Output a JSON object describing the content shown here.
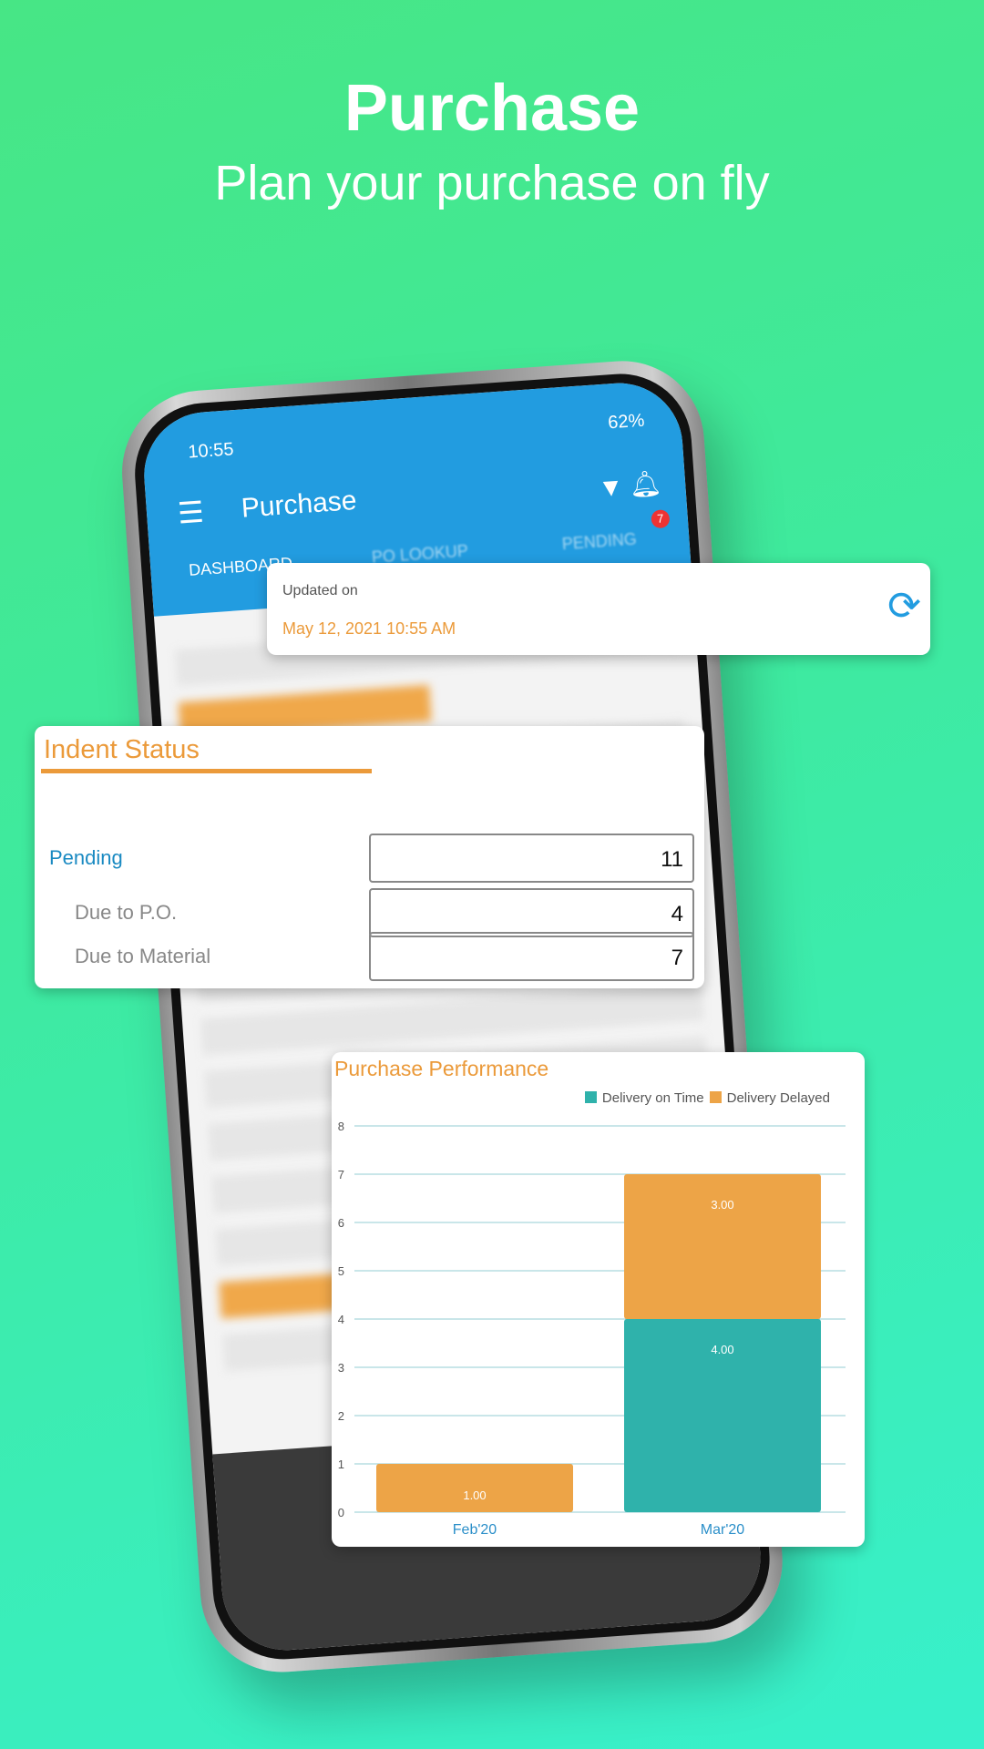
{
  "hero": {
    "title": "Purchase",
    "subtitle": "Plan your purchase on fly"
  },
  "phone": {
    "status": {
      "time": "10:55",
      "battery": "62%"
    },
    "app_title": "Purchase",
    "notification_count": "7",
    "tabs": [
      "DASHBOARD",
      "PO LOOKUP",
      "PENDING"
    ]
  },
  "updated": {
    "label": "Updated on",
    "value": "May 12, 2021 10:55 AM"
  },
  "indent": {
    "title": "Indent Status",
    "rows": [
      {
        "label": "Pending",
        "value": "11"
      },
      {
        "label": "Due to P.O.",
        "value": "4"
      },
      {
        "label": "Due to Material",
        "value": "7"
      }
    ]
  },
  "colors": {
    "on_time": "#2fb2ab",
    "delayed": "#eda447",
    "accent": "#229ce0"
  },
  "chart_data": {
    "type": "bar",
    "stacked": true,
    "title": "Purchase Performance",
    "categories": [
      "Feb'20",
      "Mar'20"
    ],
    "series": [
      {
        "name": "Delivery on Time",
        "values": [
          0,
          4
        ],
        "labels": [
          "",
          "4.00"
        ]
      },
      {
        "name": "Delivery Delayed",
        "values": [
          1,
          3
        ],
        "labels": [
          "1.00",
          "3.00"
        ]
      }
    ],
    "ylim": [
      0,
      8
    ],
    "yticks": [
      "0",
      "1",
      "2",
      "3",
      "4",
      "5",
      "6",
      "7",
      "8"
    ],
    "grid": true,
    "legend": "top-right"
  }
}
